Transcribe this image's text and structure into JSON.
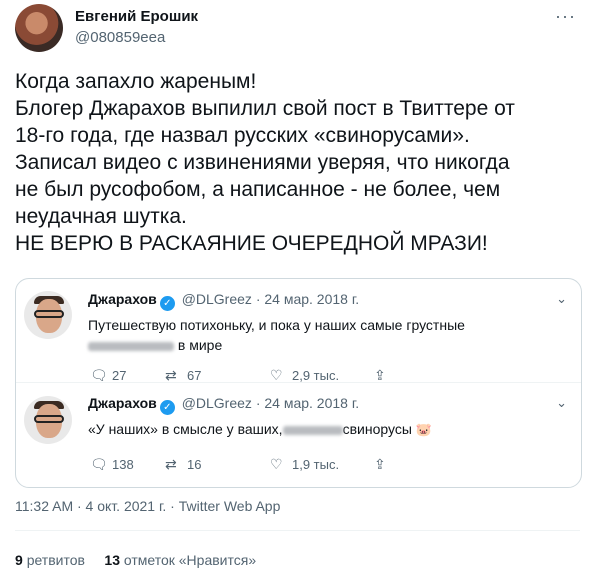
{
  "author": {
    "name": "Евгений Ерошик",
    "handle": "@080859eea",
    "more_icon": "more-dots-icon"
  },
  "tweet": {
    "lines": [
      "Когда запахло жареным!",
      "Блогер Джарахов выпилил свой пост в Твиттере от",
      "18-го года, где назвал русских «свинорусами».",
      "Записал видео с извинениями уверяя, что никогда",
      "не был русофобом, а написанное - не более, чем",
      "неудачная шутка.",
      "НЕ ВЕРЮ В РАСКАЯНИЕ ОЧЕРЕДНОЙ МРАЗИ!"
    ]
  },
  "quotes": [
    {
      "name": "Джарахов",
      "handle": "@DLGreez",
      "date": "· 24 мар. 2018 г.",
      "text_line1": "Путешествую потихоньку, и пока у наших самые грустные",
      "text_line2": "в мире",
      "replies": "27",
      "retweets": "67",
      "likes": "2,9 тыс."
    },
    {
      "name": "Джарахов",
      "handle": "@DLGreez",
      "date": "· 24 мар. 2018 г.",
      "text_a": "«У наших» в смысле у ваших,",
      "text_b": "свинорусы",
      "emoji": "🐷",
      "replies": "138",
      "retweets": "16",
      "likes": "1,9 тыс."
    }
  ],
  "footer": {
    "timestamp": "11:32 AM · 4 окт. 2021 г. · Twitter Web App",
    "retweets_count": "9",
    "retweets_label": "ретвитов",
    "likes_count": "13",
    "likes_label": "отметок «Нравится»"
  },
  "colors": {
    "text": "#0f1419",
    "secondary": "#536471",
    "verified": "#1d9bf0",
    "border": "#cfd9de"
  }
}
